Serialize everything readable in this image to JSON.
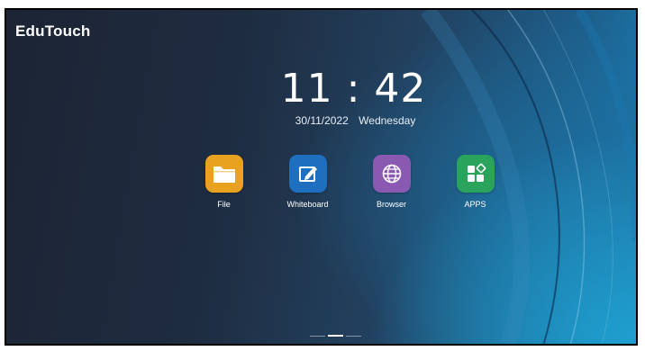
{
  "brand": {
    "name": "EduTouch"
  },
  "clock": {
    "time": "11 : 42",
    "date": "30/11/2022",
    "weekday": "Wednesday"
  },
  "apps": [
    {
      "label": "File",
      "icon": "folder-icon",
      "color": "#e9a21f"
    },
    {
      "label": "Whiteboard",
      "icon": "whiteboard-pen-icon",
      "color": "#1f6fc0"
    },
    {
      "label": "Browser",
      "icon": "globe-icon",
      "color": "#8a5ab2"
    },
    {
      "label": "APPS",
      "icon": "apps-grid-icon",
      "color": "#2aa35d"
    }
  ],
  "pager": {
    "pages": 3,
    "active_index": 1
  }
}
